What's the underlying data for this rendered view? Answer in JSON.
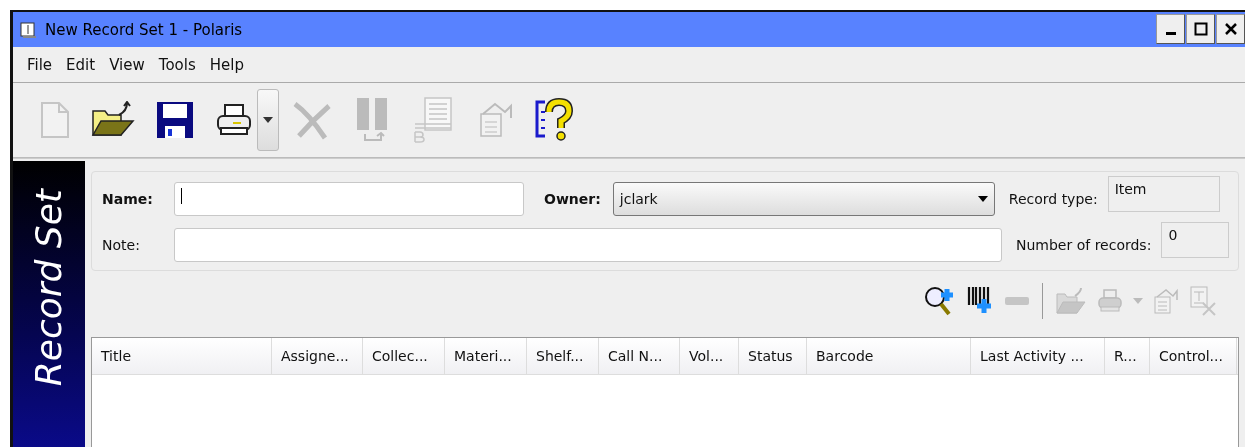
{
  "window": {
    "title": "New Record Set 1 -  Polaris"
  },
  "menu": [
    "File",
    "Edit",
    "View",
    "Tools",
    "Help"
  ],
  "toolbar": [
    {
      "kind": "new",
      "disabled": true
    },
    {
      "kind": "open",
      "disabled": false
    },
    {
      "kind": "save",
      "disabled": false
    },
    {
      "kind": "print",
      "disabled": false
    },
    {
      "kind": "dropdown",
      "disabled": false
    },
    {
      "kind": "delete",
      "disabled": true
    },
    {
      "kind": "bind",
      "disabled": true
    },
    {
      "kind": "report",
      "disabled": true
    },
    {
      "kind": "properties",
      "disabled": true
    },
    {
      "kind": "help",
      "disabled": false
    }
  ],
  "sidebar": {
    "title": "Record Set"
  },
  "form": {
    "name": {
      "label": "Name:"
    },
    "owner": {
      "label": "Owner:",
      "value": "jclark"
    },
    "record_type": {
      "label": "Record type:",
      "value": "Item"
    },
    "note": {
      "label": "Note:"
    },
    "number_of_records": {
      "label": "Number of records:",
      "value": "0"
    }
  },
  "list_toolbar": [
    {
      "kind": "find-add",
      "disabled": false
    },
    {
      "kind": "barcode-add",
      "disabled": false
    },
    {
      "kind": "remove",
      "disabled": true
    },
    {
      "kind": "separator"
    },
    {
      "kind": "open",
      "disabled": true
    },
    {
      "kind": "print",
      "disabled": true
    },
    {
      "kind": "dropdown",
      "disabled": true
    },
    {
      "kind": "properties",
      "disabled": true
    },
    {
      "kind": "delete-record",
      "disabled": true
    }
  ],
  "table": {
    "columns": [
      "Title",
      "Assigne...",
      "Collec...",
      "Materi...",
      "Shelf...",
      "Call N...",
      "Vol...",
      "Status",
      "Barcode",
      "Last Activity ...",
      "R...",
      "Control..."
    ]
  }
}
